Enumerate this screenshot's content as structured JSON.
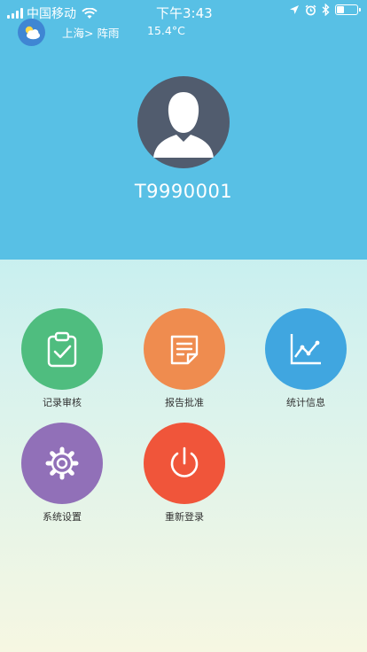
{
  "status_bar": {
    "carrier": "中国移动",
    "time": "下午3:43",
    "battery_level": 0.4
  },
  "weather": {
    "location": "上海> 阵雨",
    "temperature": "15.4°C",
    "icon": "cloud-sun-icon"
  },
  "profile": {
    "user_id": "T9990001",
    "avatar_icon": "user-silhouette-icon"
  },
  "menu": {
    "items": [
      {
        "label": "记录审核",
        "icon": "clipboard-check-icon",
        "color": "#4fbd7f"
      },
      {
        "label": "报告批准",
        "icon": "document-icon",
        "color": "#ef8c4f"
      },
      {
        "label": "统计信息",
        "icon": "line-chart-icon",
        "color": "#40a6e0"
      },
      {
        "label": "系统设置",
        "icon": "gear-icon",
        "color": "#9170b8"
      },
      {
        "label": "重新登录",
        "icon": "power-icon",
        "color": "#f0553a"
      }
    ]
  },
  "colors": {
    "header_bg": "#58c0e5",
    "avatar_bg": "#515c6e"
  }
}
